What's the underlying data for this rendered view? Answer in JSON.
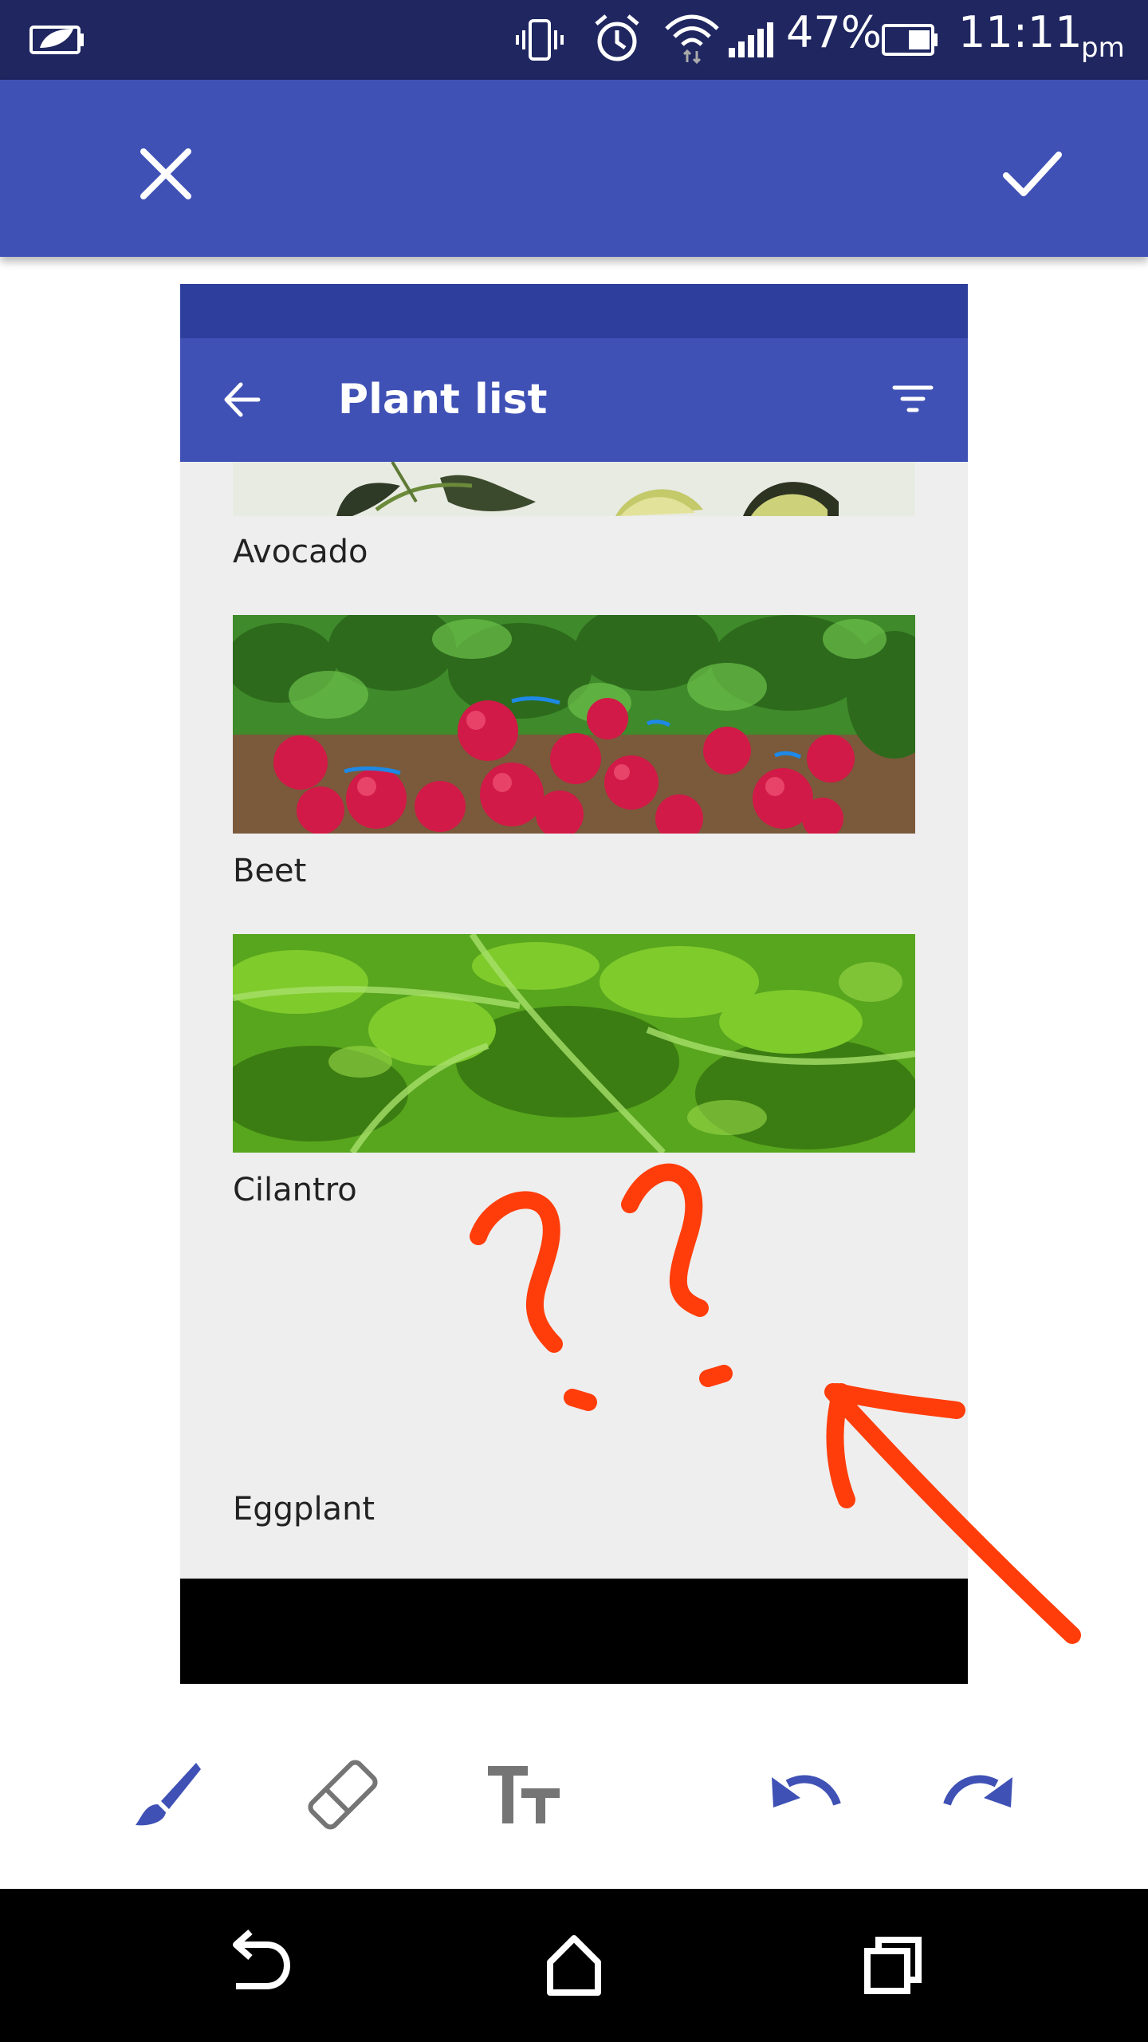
{
  "status_bar": {
    "battery_percent": "47%",
    "time": "11:11",
    "ampm": "pm"
  },
  "editor_toolbar": {
    "close_icon": "close-icon",
    "confirm_icon": "check-icon"
  },
  "screenshot": {
    "app_title": "Plant list",
    "back_icon": "arrow-back-icon",
    "filter_icon": "filter-list-icon",
    "items": [
      {
        "label": "Avocado"
      },
      {
        "label": "Beet"
      },
      {
        "label": "Cilantro"
      },
      {
        "label": "Eggplant"
      }
    ]
  },
  "annotation": {
    "color": "#ff3d0a",
    "content": "hand-drawn question marks and arrow pointing at empty eggplant image"
  },
  "tools": {
    "items": [
      "brush-icon",
      "eraser-icon",
      "text-size-icon",
      "undo-icon",
      "redo-icon"
    ],
    "accent": "#3f51b5",
    "inactive": "#757575"
  },
  "android_nav": [
    "back-icon",
    "home-icon",
    "recents-icon"
  ]
}
